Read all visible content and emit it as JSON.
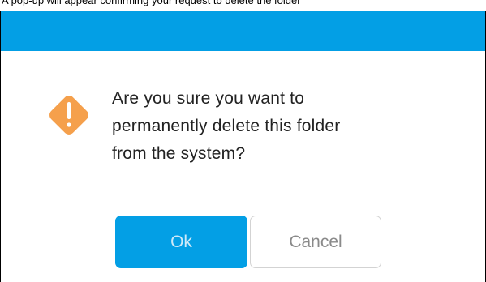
{
  "caption": "A pop-up will appear confirming your request to delete the folder",
  "dialog": {
    "icon": "warning-icon",
    "message_lines": [
      "Are you sure you want to",
      "permanently delete this folder",
      "from the system?"
    ],
    "ok_label": "Ok",
    "cancel_label": "Cancel"
  },
  "colors": {
    "header": "#039fe5",
    "ok_button": "#039fe5",
    "warning": "#f5a04c"
  }
}
